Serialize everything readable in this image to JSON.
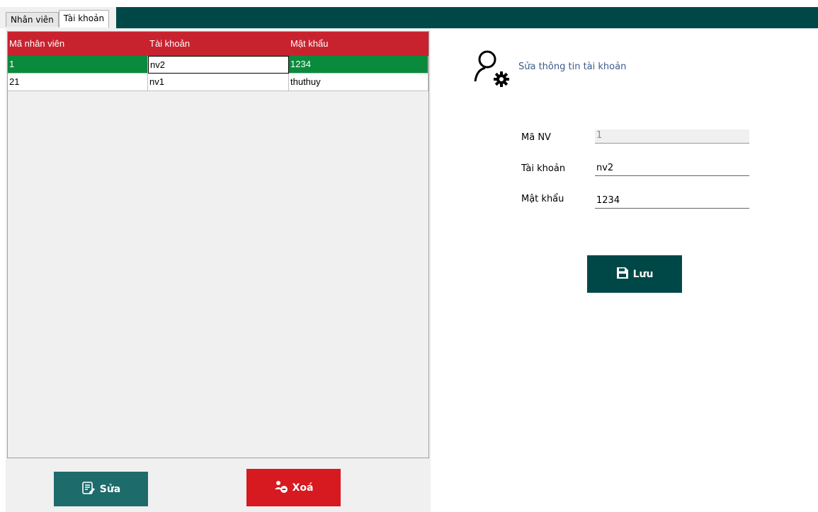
{
  "tabs": [
    {
      "label": "Nhân viên",
      "active": false
    },
    {
      "label": "Tài khoản",
      "active": true
    }
  ],
  "grid": {
    "columns": [
      "Mã nhân viên",
      "Tài khoản",
      "Mật khẩu"
    ],
    "rows": [
      {
        "id": "1",
        "account": "nv2",
        "password": "1234",
        "selected": true
      },
      {
        "id": "21",
        "account": "nv1",
        "password": "thuthuy",
        "selected": false
      }
    ],
    "header_color": "#c9222f",
    "selected_color": "#0a8a3c"
  },
  "buttons": {
    "edit_label": "Sửa",
    "delete_label": "Xoá",
    "save_label": "Lưu"
  },
  "form": {
    "title": "Sửa thông tin tài khoản",
    "employee_id_label": "Mã NV",
    "employee_id_value": "1",
    "account_label": "Tài khoản",
    "account_value": "nv2",
    "password_label": "Mật khẩu",
    "password_value": "1234"
  },
  "icons": {
    "header": "user-gear-icon",
    "edit": "edit-list-icon",
    "delete": "user-remove-icon",
    "save": "floppy-disk-icon"
  },
  "colors": {
    "top_bar": "#004848",
    "edit_button": "#1e6b6c",
    "delete_button": "#d71920",
    "save_button": "#004848"
  }
}
